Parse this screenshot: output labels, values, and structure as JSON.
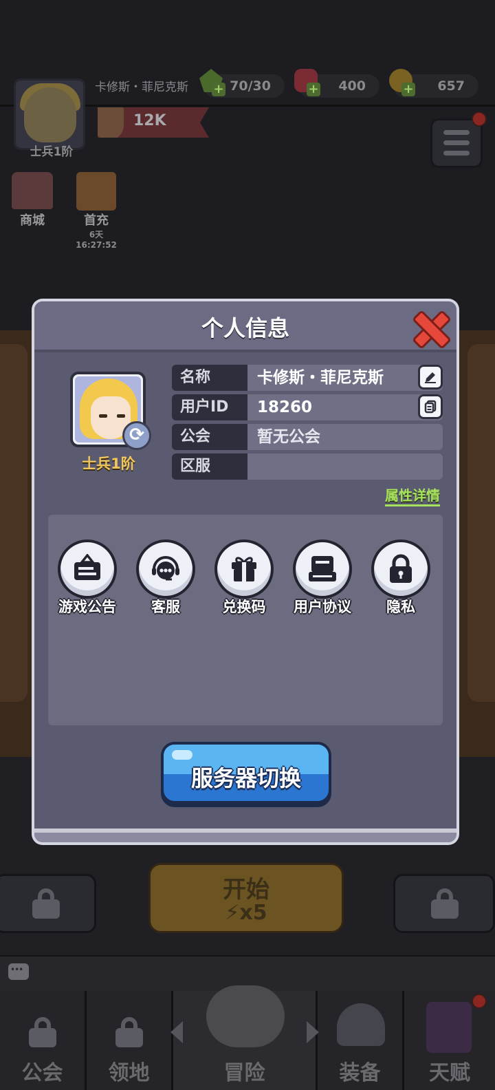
{
  "top_bar": {
    "player_name": "卡修斯・菲尼克斯",
    "rank": "士兵1阶",
    "stamina": "70/30",
    "gems": "400",
    "gold": "657",
    "power": "12K"
  },
  "side_buttons": {
    "shop_label": "商城",
    "first_recharge_label": "首充",
    "first_recharge_timer": "6天16:27:52"
  },
  "modal": {
    "title": "个人信息",
    "avatar_rank": "士兵1阶",
    "rows": {
      "name": {
        "label": "名称",
        "value": "卡修斯・菲尼克斯"
      },
      "uid": {
        "label": "用户ID",
        "value": "18260"
      },
      "guild": {
        "label": "公会",
        "value": "暂无公会"
      },
      "server": {
        "label": "区服",
        "value": ""
      }
    },
    "attribute_link": "属性详情",
    "functions": [
      {
        "label": "游戏公告",
        "icon": "notice-board-icon"
      },
      {
        "label": "客服",
        "icon": "customer-service-icon"
      },
      {
        "label": "兑换码",
        "icon": "gift-icon"
      },
      {
        "label": "用户协议",
        "icon": "agreement-icon"
      },
      {
        "label": "隐私",
        "icon": "lock-icon"
      }
    ],
    "server_switch_label": "服务器切换"
  },
  "start_button": {
    "label": "开始",
    "cost": "x5"
  },
  "bottom_nav": [
    {
      "label": "公会",
      "icon": "lock-icon"
    },
    {
      "label": "领地",
      "icon": "lock-icon"
    },
    {
      "label": "冒险",
      "icon": "crossed-axes-icon"
    },
    {
      "label": "装备",
      "icon": "helmet-icon"
    },
    {
      "label": "天赋",
      "icon": "spellbook-icon"
    }
  ],
  "colors": {
    "accent_blue": "#5ab5f2",
    "close_red": "#e5473b",
    "link_green": "#a7e25c",
    "rank_gold": "#f1c65a"
  }
}
